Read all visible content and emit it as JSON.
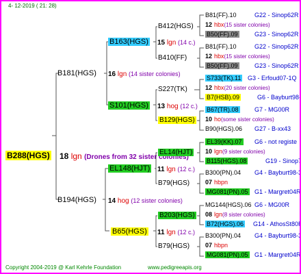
{
  "date": "4- 12-2019 ( 21: 28)",
  "root": {
    "name": "B288(HGS)",
    "num": "18",
    "lgn": "lgn",
    "drones": "(Drones from 32 sister colonies)"
  },
  "gen1": [
    {
      "name": "B181(HGS)",
      "num": "16",
      "tag": "lgn",
      "sisters": "(14 sister colonies)"
    },
    {
      "name": "B194(HGS)",
      "num": "14",
      "tag": "hog",
      "sisters": "(12 sister colonies)"
    }
  ],
  "gen2": [
    {
      "name": "B163(HGS)",
      "num": "15",
      "tag": "lgn",
      "sisters": "(14 c.)"
    },
    {
      "name": "S101(HGS)",
      "num": "13",
      "tag": "hog",
      "sisters": "(12 c.)"
    },
    {
      "name": "EL148(HJT)",
      "num": "11",
      "tag": "lgn",
      "sisters": "(12 c.)"
    },
    {
      "name": "B65(HGS)",
      "num": "11",
      "tag": "lgn",
      "sisters": "(12 c.)"
    }
  ],
  "gen3": [
    {
      "name": "B412(HGS)"
    },
    {
      "name": "B410(FF)"
    },
    {
      "name": "S227(TK)"
    },
    {
      "name": "B129(HGS)"
    },
    {
      "name": "EL14(HJT)"
    },
    {
      "name": "B79(HGS)"
    },
    {
      "name": "B203(HGS)"
    },
    {
      "name": "B79(HGS)"
    }
  ],
  "gen4": [
    {
      "dam": "B81(FF).10",
      "dam_loc": "G22 - Sinop62R",
      "num": "12",
      "tag": "hbx",
      "sisters": "(15 sister colonies)",
      "sire": "B50(FF).09",
      "sire_loc": "G23 - Sinop62R"
    },
    {
      "dam": "B81(FF).10",
      "dam_loc": "G22 - Sinop62R",
      "num": "12",
      "tag": "hbx",
      "sisters": "(15 sister colonies)",
      "sire": "B50(FF).09",
      "sire_loc": "G23 - Sinop62R"
    },
    {
      "dam": "S733(TK).11",
      "dam_loc": "G3 - Erfoud07-1Q",
      "num": "12",
      "tag": "hbx",
      "sisters": "(20 sister colonies)",
      "sire": "B7(HSB).09",
      "sire_loc": "G6 - Bayburt98-3"
    },
    {
      "dam": "B67(TR).08",
      "dam_loc": "G7 - MG00R",
      "num": "10",
      "tag": "ho",
      "sisters": "(some sister colonies)",
      "sire": "B90(HGS).06",
      "sire_loc": "G27 - B-xx43"
    },
    {
      "dam": "EL39(KK).07",
      "dam_loc": "G6 - not registe",
      "num": "10",
      "tag": "lgn",
      "sisters": "(9 sister colonies)",
      "sire": "B115(HGS).08",
      "sire_loc": "G19 - Sinop72R"
    },
    {
      "dam": "B300(PN).04",
      "dam_loc": "G4 - Bayburt98-3",
      "num": "07",
      "tag": "hbpn",
      "sisters": "",
      "sire": "MG081(PN).05",
      "sire_loc": "G1 - Margret04R"
    },
    {
      "dam": "MG144(HGS).06",
      "dam_loc": "G6 - MG00R",
      "num": "08",
      "tag": "lgn",
      "sisters": "(8 sister colonies)",
      "sire": "B72(HGS).06",
      "sire_loc": "G14 - AthosSt80R"
    },
    {
      "dam": "B300(PN).04",
      "dam_loc": "G4 - Bayburt98-3",
      "num": "07",
      "tag": "hbpn",
      "sisters": "",
      "sire": "MG081(PN).05",
      "sire_loc": "G1 - Margret04R"
    }
  ],
  "footer": {
    "copyright": "Copyright 2004-2019 @ Karl Kehrle Foundation",
    "site": "www.pedigreeapis.org"
  },
  "colors": {
    "border": "#ff00ff",
    "cyan": "#33ccff",
    "green": "#22cc22",
    "grey": "#8c8c8c",
    "yellow": "#ffff00",
    "root_bg": "#ffff00"
  }
}
